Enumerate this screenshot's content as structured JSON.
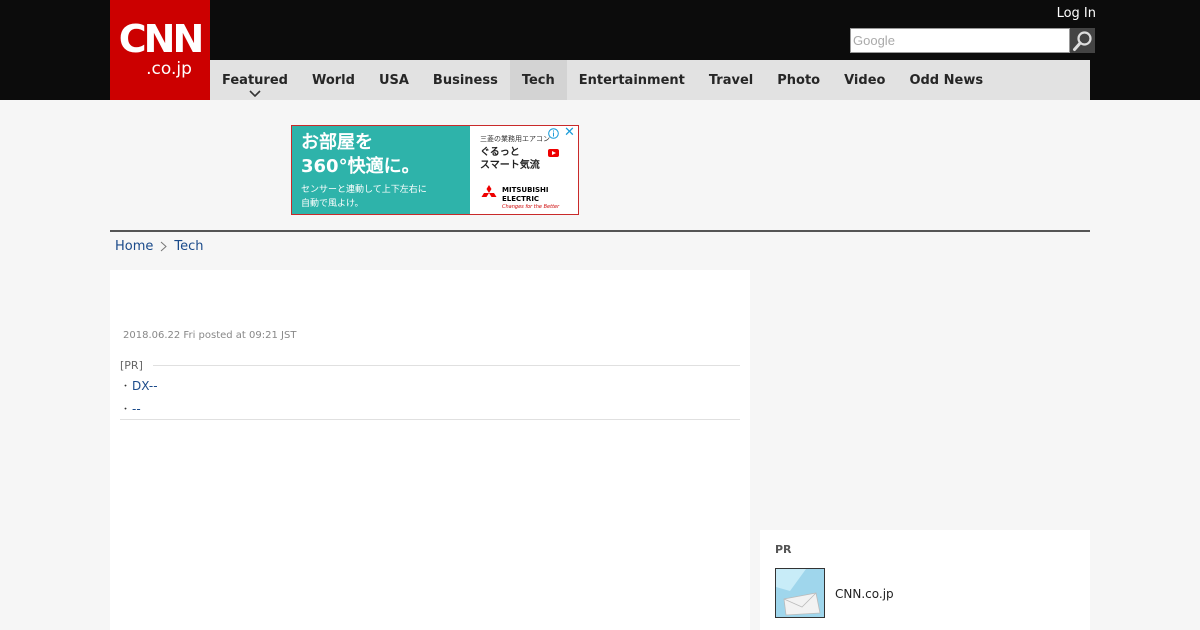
{
  "header": {
    "logo": {
      "main": "CNN",
      "sub": ".co.jp"
    },
    "login_label": "Log In",
    "search": {
      "placeholder": "Google",
      "value": ""
    },
    "nav": [
      {
        "label": "Featured",
        "has_dropdown": true,
        "active": false
      },
      {
        "label": "World",
        "active": false
      },
      {
        "label": "USA",
        "active": false
      },
      {
        "label": "Business",
        "active": false
      },
      {
        "label": "Tech",
        "active": true
      },
      {
        "label": "Entertainment",
        "active": false
      },
      {
        "label": "Travel",
        "active": false
      },
      {
        "label": "Photo",
        "active": false
      },
      {
        "label": "Video",
        "active": false
      },
      {
        "label": "Odd News",
        "active": false
      }
    ]
  },
  "ad": {
    "headline_1": "お部屋を",
    "headline_2": "360°快適に。",
    "subline_1": "センサーと連動して上下左右に",
    "subline_2": "自動で風よけ。",
    "small_text": "三菱の業務用エアコン",
    "copy_1": "ぐるっと",
    "copy_2": "スマート気流",
    "brand": "MITSUBISHI ELECTRIC",
    "tagline": "Changes for the Better",
    "close_glyph": "✕"
  },
  "breadcrumb": [
    {
      "label": "Home"
    },
    {
      "label": "Tech"
    }
  ],
  "article": {
    "date": "2018.06.22 Fri posted at 09:21 JST",
    "pr_label": "[PR]",
    "pr_links": [
      {
        "bullet": "・",
        "label": "DX--"
      },
      {
        "bullet": "・",
        "label": "--"
      }
    ]
  },
  "sidebar_pr": {
    "label": "PR",
    "item_title": "CNN.co.jp"
  },
  "colors": {
    "brand_red": "#cc0000",
    "header_bg": "#0c0c0c",
    "nav_bg": "#e2e2e2",
    "link": "#1a4a8a"
  }
}
